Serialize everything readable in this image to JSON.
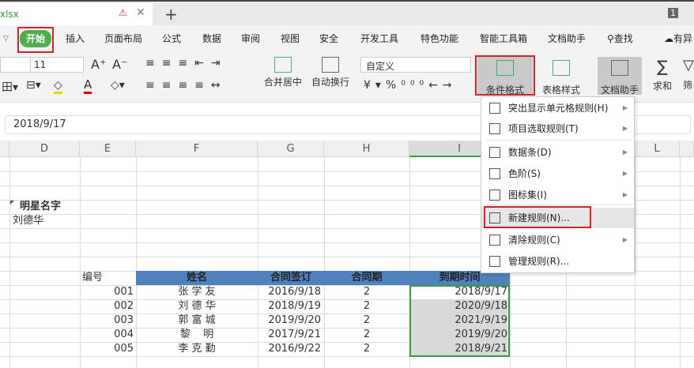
{
  "tab": {
    "filename": "xlsx",
    "warning_icon": "warning-icon",
    "close_icon": "close-icon",
    "new_tab": "+",
    "badge": "1"
  },
  "menu": [
    "开始",
    "插入",
    "页面布局",
    "公式",
    "数据",
    "审阅",
    "视图",
    "安全",
    "开发工具",
    "特色功能",
    "智能工具箱",
    "文档助手",
    "查找",
    "有异"
  ],
  "toolbar": {
    "font_size": "11",
    "number_format": "自定义",
    "merge": "合并居中",
    "wrap": "自动换行",
    "cond_format": "条件格式",
    "table_style": "表格样式",
    "doc_helper": "文档助手",
    "sum": "求和",
    "filter": "筛"
  },
  "formula_bar": {
    "value": "2018/9/17"
  },
  "columns": [
    "D",
    "E",
    "F",
    "G",
    "H",
    "I",
    "L"
  ],
  "cells": {
    "title": "明星名字",
    "name": "刘德华"
  },
  "table": {
    "headers": [
      "编号",
      "姓名",
      "合同签订",
      "合同期",
      "到期时间"
    ],
    "rows": [
      [
        "001",
        "张 学 友",
        "2016/9/18",
        "2",
        "2018/9/17"
      ],
      [
        "002",
        "刘 德 华",
        "2018/9/19",
        "2",
        "2020/9/18"
      ],
      [
        "003",
        "郭 富 城",
        "2019/9/20",
        "2",
        "2021/9/19"
      ],
      [
        "004",
        "黎    明",
        "2017/9/21",
        "2",
        "2019/9/20"
      ],
      [
        "005",
        "李 克 勤",
        "2016/9/22",
        "2",
        "2018/9/21"
      ]
    ]
  },
  "dropdown": [
    {
      "label": "突出显示单元格规则(H)",
      "sub": true
    },
    {
      "label": "项目选取规则(T)",
      "sub": true
    },
    {
      "label": "数据条(D)",
      "sub": true
    },
    {
      "label": "色阶(S)",
      "sub": true
    },
    {
      "label": "图标集(I)",
      "sub": true
    },
    {
      "label": "新建规则(N)...",
      "sub": false
    },
    {
      "label": "清除规则(C)",
      "sub": true
    },
    {
      "label": "管理规则(R)...",
      "sub": false
    }
  ],
  "colors": {
    "accent": "#4caf50",
    "header_fill": "#4f81bd",
    "highlight": "#e02020",
    "selection": "#3a9b3a"
  }
}
